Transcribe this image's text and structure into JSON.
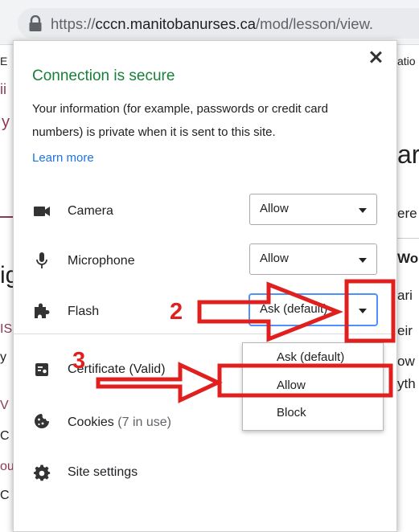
{
  "browser": {
    "url_scheme": "https://",
    "url_host": "cccn.manitobanurses.ca",
    "url_path": "/mod/lesson/view."
  },
  "background_page": {
    "fragments": [
      "E",
      "atio",
      "ii",
      "y",
      "ar",
      "ere",
      "Wor",
      "ig",
      "ari",
      "eir",
      "IS",
      "y",
      "ow",
      "yth",
      "V",
      "C",
      "ou",
      "C"
    ]
  },
  "popup": {
    "title": "Connection is secure",
    "description": "Your information (for example, passwords or credit card numbers) is private when it is sent to this site.",
    "learn_more": "Learn more",
    "permissions": [
      {
        "label": "Camera",
        "value": "Allow",
        "icon": "camera-icon"
      },
      {
        "label": "Microphone",
        "value": "Allow",
        "icon": "microphone-icon"
      },
      {
        "label": "Flash",
        "value": "Ask (default)",
        "icon": "puzzle-icon"
      }
    ],
    "dropdown_options": [
      "Ask (default)",
      "Allow",
      "Block"
    ],
    "items": [
      {
        "label": "Certificate (Valid)",
        "icon": "certificate-icon"
      },
      {
        "label": "Cookies",
        "note": "(7 in use)",
        "icon": "cookie-icon"
      },
      {
        "label": "Site settings",
        "icon": "gear-icon"
      }
    ]
  },
  "annotations": {
    "label_2": "2",
    "label_3": "3",
    "color": "#e0201f"
  }
}
